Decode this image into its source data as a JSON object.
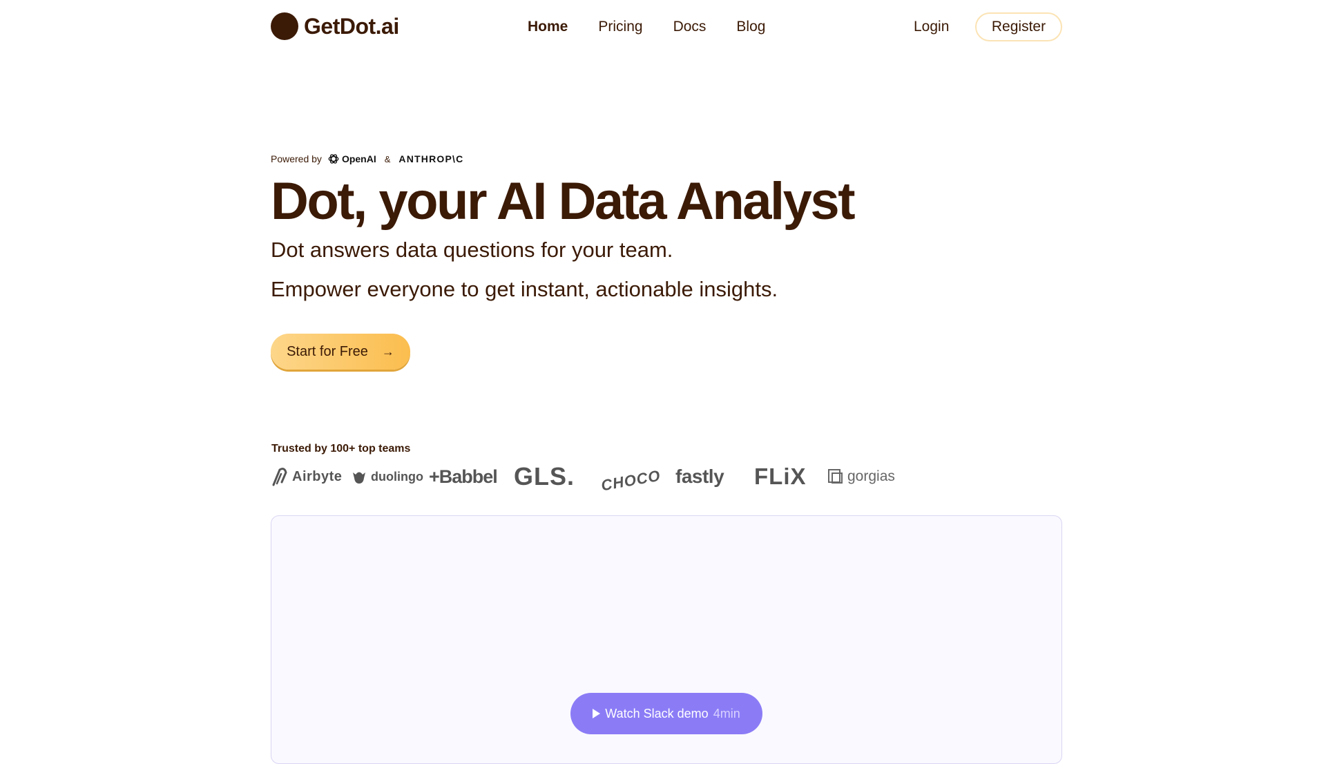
{
  "nav": {
    "brand": "GetDot.ai",
    "links": [
      {
        "label": "Home",
        "active": true
      },
      {
        "label": "Pricing",
        "active": false
      },
      {
        "label": "Docs",
        "active": false
      },
      {
        "label": "Blog",
        "active": false
      }
    ],
    "login": "Login",
    "register": "Register"
  },
  "hero": {
    "powered_by": "Powered by",
    "openai": "OpenAI",
    "amp": "&",
    "anthropic": "ANTHROP\\C",
    "title": "Dot, your AI Data Analyst",
    "subtitle_1": "Dot answers data questions for your team.",
    "subtitle_2": "Empower everyone to get instant, actionable insights.",
    "cta": "Start for Free"
  },
  "trusted": {
    "label": "Trusted by 100+ top teams",
    "logos": [
      "Airbyte",
      "duolingo",
      "+Babbel",
      "GLS.",
      "CHOCO",
      "fastly",
      "FLiX",
      "gorgias"
    ]
  },
  "demo": {
    "button_label": "Watch Slack demo",
    "duration": "4min"
  },
  "colors": {
    "brand_brown": "#3b1a06",
    "cta_yellow": "#fbbd4e",
    "demo_purple": "#8b7cf6",
    "register_border": "#fbe3b4"
  }
}
